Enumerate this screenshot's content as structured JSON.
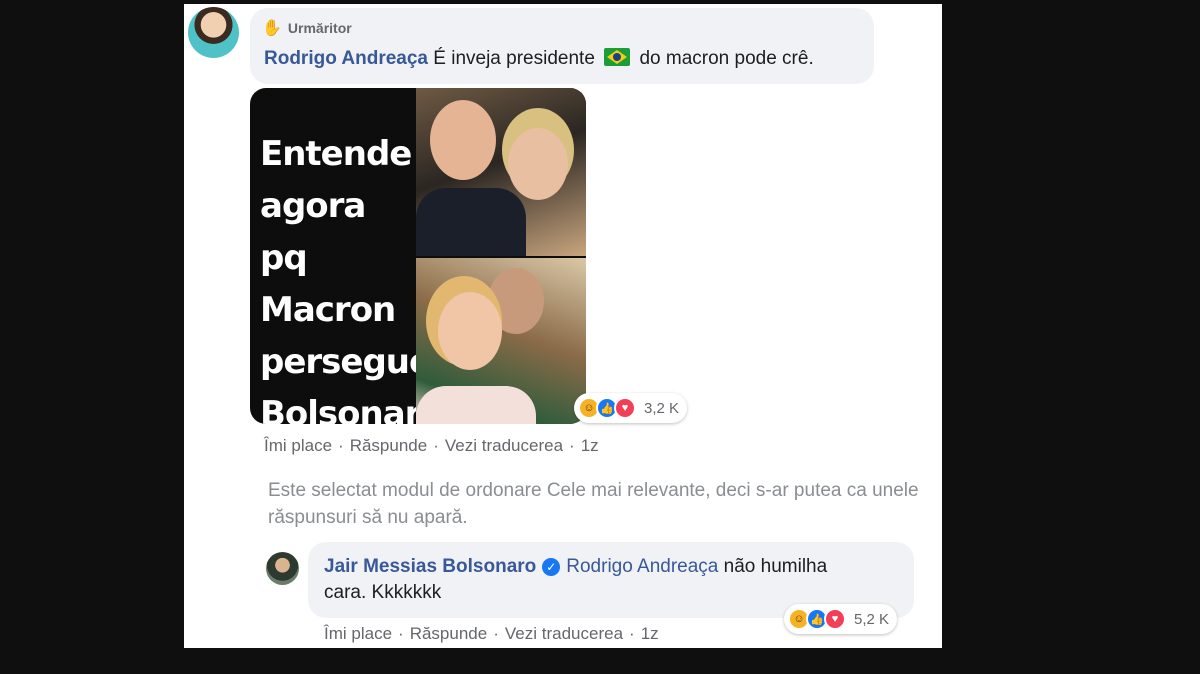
{
  "comment1": {
    "badge": "Urmăritor",
    "author": "Rodrigo Andreaça",
    "text_before_flag": "É inveja presidente",
    "flag_icon": "brazil-flag-icon",
    "text_after_flag": "do macron pode crê.",
    "meme": {
      "lines": [
        "Entende",
        "agora",
        "pq Macron",
        "persegue",
        "Bolsonaro?"
      ]
    },
    "reactions": {
      "icons": [
        "haha-icon",
        "like-icon",
        "love-icon"
      ],
      "count": "3,2 K"
    },
    "actions": {
      "like": "Îmi place",
      "reply": "Răspunde",
      "translate": "Vezi traducerea",
      "time": "1z"
    }
  },
  "notice": "Este selectat modul de ordonare Cele mai relevante, deci s-ar putea ca unele răspunsuri să nu apară.",
  "reply": {
    "author": "Jair Messias Bolsonaro",
    "mention": "Rodrigo Andreaça",
    "text_line1": "não humilha",
    "text_line2": "cara. Kkkkkkk",
    "reactions": {
      "icons": [
        "haha-icon",
        "like-icon",
        "love-icon"
      ],
      "count": "5,2 K"
    },
    "actions": {
      "like": "Îmi place",
      "reply": "Răspunde",
      "translate": "Vezi traducerea",
      "time": "1z"
    }
  },
  "colors": {
    "author_blue": "#385898",
    "bubble_bg": "#f0f2f5",
    "meta_gray": "#65676b"
  }
}
